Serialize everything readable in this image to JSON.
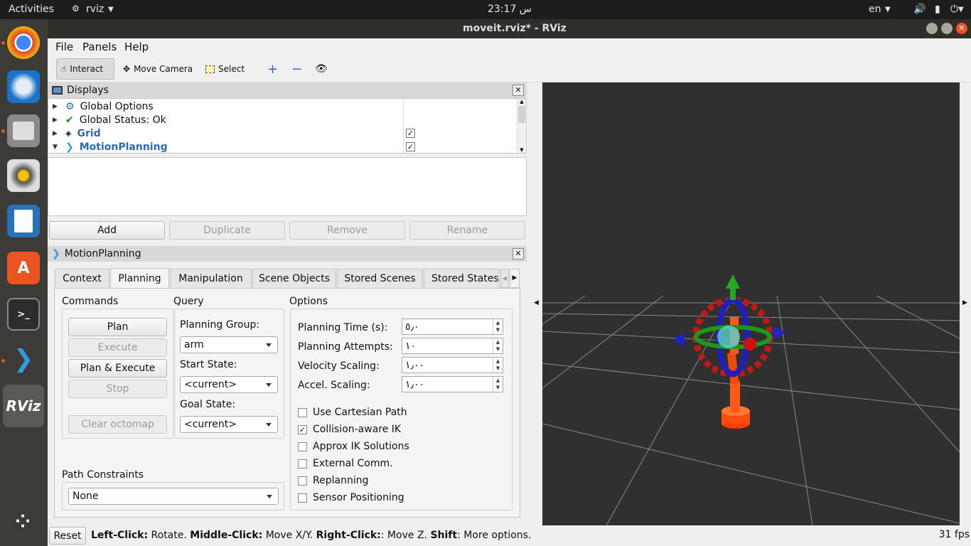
{
  "topbar": {
    "activities": "Activities",
    "app": "rviz",
    "clock": "23:17 س",
    "lang": "en"
  },
  "dock": {
    "items": [
      "chrome-icon",
      "thunderbird-icon",
      "files-icon",
      "rhythmbox-icon",
      "writer-icon",
      "software-icon",
      "terminal-icon",
      "vscode-icon",
      "rviz-icon",
      "apps-grid-icon"
    ],
    "rviz_label": "RViz"
  },
  "window": {
    "title": "moveit.rviz* - RViz"
  },
  "menubar": {
    "file": "File",
    "panels": "Panels",
    "help": "Help"
  },
  "toolbar": {
    "interact": "Interact",
    "move_camera": "Move Camera",
    "select": "Select"
  },
  "displays": {
    "title": "Displays",
    "items": [
      {
        "label": "Global Options",
        "checked": null
      },
      {
        "label": "Global Status: Ok",
        "checked": null
      },
      {
        "label": "Grid",
        "checked": true
      },
      {
        "label": "MotionPlanning",
        "checked": true
      }
    ],
    "buttons": {
      "add": "Add",
      "duplicate": "Duplicate",
      "remove": "Remove",
      "rename": "Rename"
    }
  },
  "motion_planning": {
    "title": "MotionPlanning",
    "tabs": [
      "Context",
      "Planning",
      "Manipulation",
      "Scene Objects",
      "Stored Scenes",
      "Stored States"
    ],
    "selected_tab": "Planning",
    "commands": {
      "title": "Commands",
      "plan": "Plan",
      "execute": "Execute",
      "plan_execute": "Plan & Execute",
      "stop": "Stop",
      "clear_octomap": "Clear octomap"
    },
    "query": {
      "title": "Query",
      "planning_group_label": "Planning Group:",
      "planning_group": "arm",
      "start_state_label": "Start State:",
      "start_state": "<current>",
      "goal_state_label": "Goal State:",
      "goal_state": "<current>"
    },
    "options": {
      "title": "Options",
      "planning_time_label": "Planning Time (s):",
      "planning_time": "٥٫٠",
      "planning_attempts_label": "Planning Attempts:",
      "planning_attempts": "١٠",
      "velocity_scaling_label": "Velocity Scaling:",
      "velocity_scaling": "١٫٠٠",
      "accel_scaling_label": "Accel. Scaling:",
      "accel_scaling": "١٫٠٠",
      "checkboxes": [
        {
          "label": "Use Cartesian Path",
          "checked": false
        },
        {
          "label": "Collision-aware IK",
          "checked": true
        },
        {
          "label": "Approx IK Solutions",
          "checked": false
        },
        {
          "label": "External Comm.",
          "checked": false
        },
        {
          "label": "Replanning",
          "checked": false
        },
        {
          "label": "Sensor Positioning",
          "checked": false
        }
      ]
    },
    "path_constraints": {
      "title": "Path Constraints",
      "value": "None"
    }
  },
  "status": {
    "reset": "Reset",
    "left_click": "Left-Click:",
    "left_desc": " Rotate. ",
    "middle_click": "Middle-Click:",
    "middle_desc": " Move X/Y. ",
    "right_click": "Right-Click:",
    "right_desc": ": Move Z. ",
    "shift": "Shift",
    "shift_desc": ": More options.",
    "fps": "31 fps"
  },
  "colors": {
    "accent": "#e95420",
    "link_blue": "#2a6ac0",
    "viewport_bg": "#303030"
  }
}
